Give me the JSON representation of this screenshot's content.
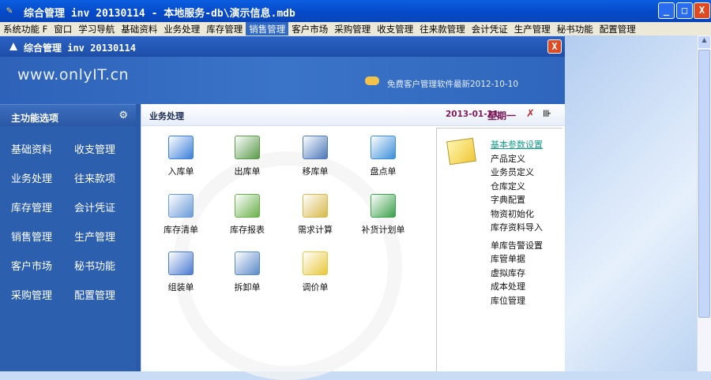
{
  "window": {
    "title": "综合管理 inv 20130114 - 本地服务-db\\演示信息.mdb",
    "minimize": "_",
    "maximize": "□",
    "close": "X"
  },
  "menu": [
    "系统功能 F",
    "窗口",
    "学习导航",
    "基础资料",
    "业务处理",
    "库存管理",
    "销售管理",
    "客户市场",
    "采购管理",
    "收支管理",
    "往来款管理",
    "会计凭证",
    "生产管理",
    "秘书功能",
    "配置管理"
  ],
  "menu_active": "销售管理",
  "inner": {
    "title": "综合管理 inv 20130114",
    "close": "X",
    "logo": "www.onlyIT.cn",
    "news": "免费客户管理软件最新2012-10-10"
  },
  "sidebar": {
    "header": "主功能选项",
    "items": [
      "基础资料",
      "收支管理",
      "业务处理",
      "往来款项",
      "库存管理",
      "会计凭证",
      "销售管理",
      "生产管理",
      "客户市场",
      "秘书功能",
      "采购管理",
      "配置管理"
    ]
  },
  "content": {
    "title": "业务处理",
    "date": "2013-01-21",
    "weekday": "星期一",
    "tiles": [
      {
        "label": "入库单",
        "color": "#3a7fd8"
      },
      {
        "label": "出库单",
        "color": "#5a9a4a"
      },
      {
        "label": "移库单",
        "color": "#4a78b8"
      },
      {
        "label": "盘点单",
        "color": "#3a8fd8"
      },
      {
        "label": "库存清单",
        "color": "#6a9ad8"
      },
      {
        "label": "库存报表",
        "color": "#6ab04a"
      },
      {
        "label": "需求计算",
        "color": "#d8b84a"
      },
      {
        "label": "补货计划单",
        "color": "#3aa04a"
      },
      {
        "label": "组装单",
        "color": "#4a7ad0"
      },
      {
        "label": "拆卸单",
        "color": "#5a8ac8"
      },
      {
        "label": "调价单",
        "color": "#e8c83a"
      }
    ],
    "links": [
      "基本参数设置",
      "产品定义",
      "业务员定义",
      "仓库定义",
      "字典配置",
      "物资初始化",
      "库存资料导入",
      "单库告警设置",
      "库管单据",
      "虚拟库存",
      "成本处理",
      "库位管理"
    ]
  }
}
